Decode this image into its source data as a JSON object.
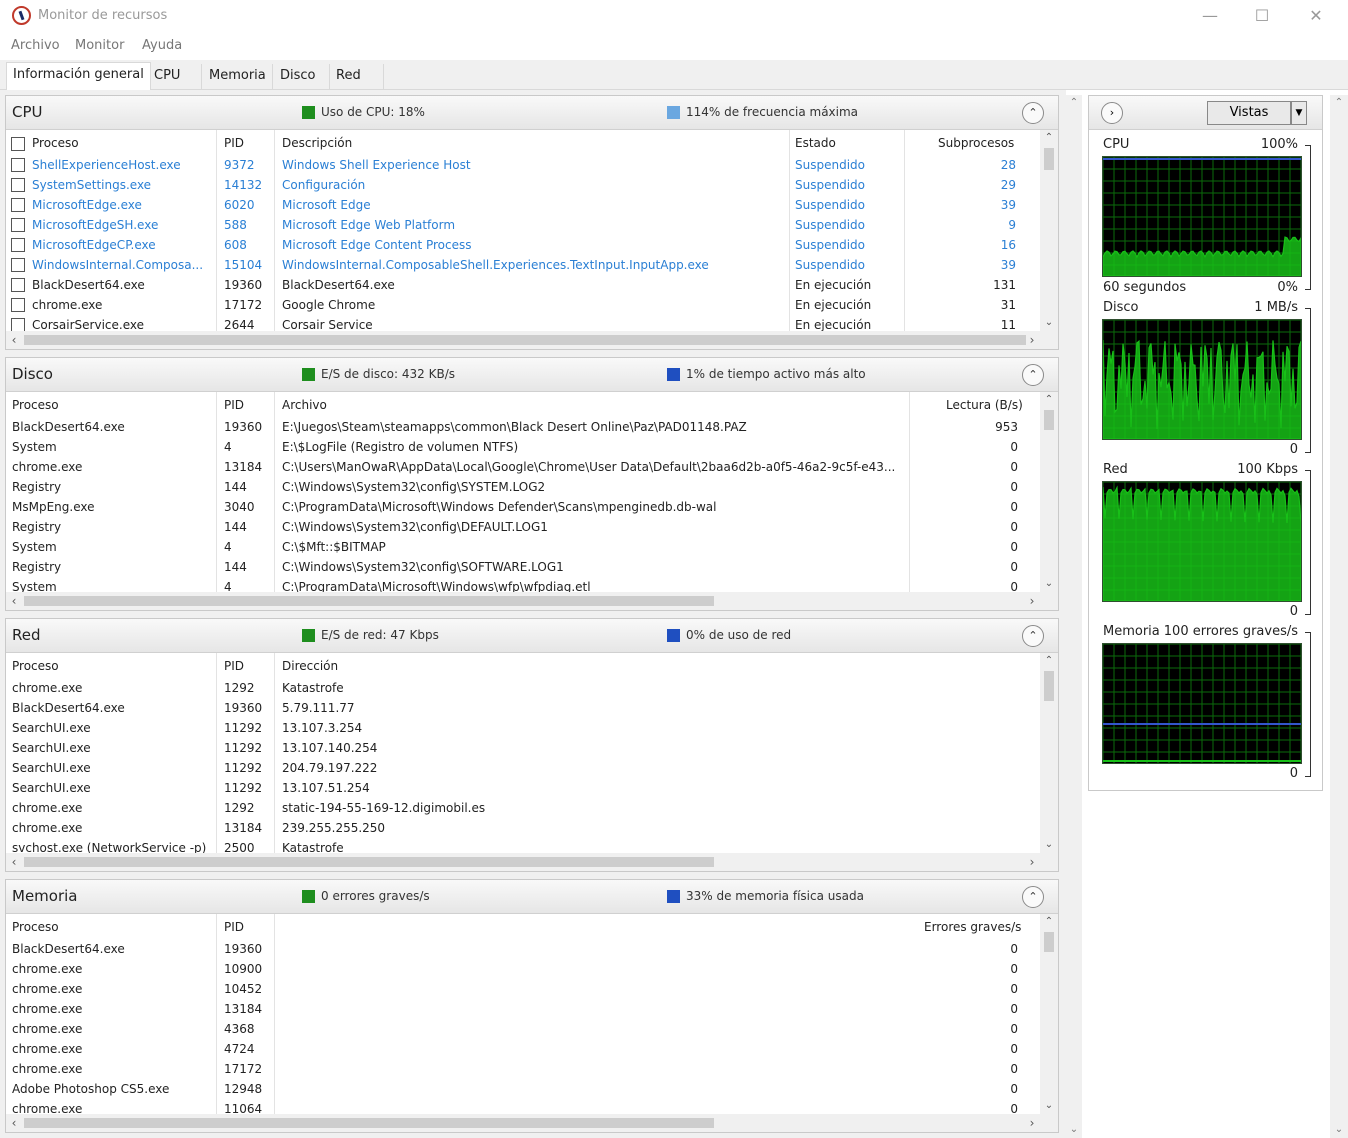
{
  "window": {
    "title": "Monitor de recursos",
    "minimize": "—",
    "maximize": "☐",
    "close": "✕"
  },
  "menu": [
    "Archivo",
    "Monitor",
    "Ayuda"
  ],
  "tabs": [
    "Información general",
    "CPU",
    "Memoria",
    "Disco",
    "Red"
  ],
  "colors": {
    "legend_green": "#1e8e1e",
    "legend_blue": "#1f4fc0",
    "link_blue": "#2a7fd4",
    "graph_green": "#18c018",
    "graph_grid": "#0b6b0b",
    "graph_blue_line": "#3355cc"
  },
  "cpu": {
    "title": "CPU",
    "legend1": "Uso de CPU: 18%",
    "legend2": "114% de frecuencia máxima",
    "headers": [
      "Proceso",
      "PID",
      "Descripción",
      "Estado",
      "Subprocesos"
    ],
    "rows": [
      [
        "ShellExperienceHost.exe",
        "9372",
        "Windows Shell Experience Host",
        "Suspendido",
        "28"
      ],
      [
        "SystemSettings.exe",
        "14132",
        "Configuración",
        "Suspendido",
        "29"
      ],
      [
        "MicrosoftEdge.exe",
        "6020",
        "Microsoft Edge",
        "Suspendido",
        "39"
      ],
      [
        "MicrosoftEdgeSH.exe",
        "588",
        "Microsoft Edge Web Platform",
        "Suspendido",
        "9"
      ],
      [
        "MicrosoftEdgeCP.exe",
        "608",
        "Microsoft Edge Content Process",
        "Suspendido",
        "16"
      ],
      [
        "WindowsInternal.Composa...",
        "15104",
        "WindowsInternal.ComposableShell.Experiences.TextInput.InputApp.exe",
        "Suspendido",
        "39"
      ],
      [
        "BlackDesert64.exe",
        "19360",
        "BlackDesert64.exe",
        "En ejecución",
        "131"
      ],
      [
        "chrome.exe",
        "17172",
        "Google Chrome",
        "En ejecución",
        "31"
      ],
      [
        "CorsairService.exe",
        "2644",
        "Corsair Service",
        "En ejecución",
        "11"
      ]
    ]
  },
  "disk": {
    "title": "Disco",
    "legend1": "E/S de disco: 432 KB/s",
    "legend2": "1% de tiempo activo más alto",
    "headers": [
      "Proceso",
      "PID",
      "Archivo",
      "Lectura (B/s)"
    ],
    "rows": [
      [
        "BlackDesert64.exe",
        "19360",
        "E:\\Juegos\\Steam\\steamapps\\common\\Black Desert Online\\Paz\\PAD01148.PAZ",
        "953"
      ],
      [
        "System",
        "4",
        "E:\\$LogFile (Registro de volumen NTFS)",
        "0"
      ],
      [
        "chrome.exe",
        "13184",
        "C:\\Users\\ManOwaR\\AppData\\Local\\Google\\Chrome\\User Data\\Default\\2baa6d2b-a0f5-46a2-9c5f-e43...",
        "0"
      ],
      [
        "Registry",
        "144",
        "C:\\Windows\\System32\\config\\SYSTEM.LOG2",
        "0"
      ],
      [
        "MsMpEng.exe",
        "3040",
        "C:\\ProgramData\\Microsoft\\Windows Defender\\Scans\\mpenginedb.db-wal",
        "0"
      ],
      [
        "Registry",
        "144",
        "C:\\Windows\\System32\\config\\DEFAULT.LOG1",
        "0"
      ],
      [
        "System",
        "4",
        "C:\\$Mft::$BITMAP",
        "0"
      ],
      [
        "Registry",
        "144",
        "C:\\Windows\\System32\\config\\SOFTWARE.LOG1",
        "0"
      ],
      [
        "System",
        "4",
        "C:\\ProgramData\\Microsoft\\Windows\\wfp\\wfpdiag.etl",
        "0"
      ]
    ]
  },
  "network": {
    "title": "Red",
    "legend1": "E/S de red: 47 Kbps",
    "legend2": "0% de uso de red",
    "headers": [
      "Proceso",
      "PID",
      "Dirección"
    ],
    "rows": [
      [
        "chrome.exe",
        "1292",
        "Katastrofe"
      ],
      [
        "BlackDesert64.exe",
        "19360",
        "5.79.111.77"
      ],
      [
        "SearchUI.exe",
        "11292",
        "13.107.3.254"
      ],
      [
        "SearchUI.exe",
        "11292",
        "13.107.140.254"
      ],
      [
        "SearchUI.exe",
        "11292",
        "204.79.197.222"
      ],
      [
        "SearchUI.exe",
        "11292",
        "13.107.51.254"
      ],
      [
        "chrome.exe",
        "1292",
        "static-194-55-169-12.digimobil.es"
      ],
      [
        "chrome.exe",
        "13184",
        "239.255.255.250"
      ],
      [
        "svchost.exe (NetworkService -p)",
        "2500",
        "Katastrofe"
      ]
    ]
  },
  "memory": {
    "title": "Memoria",
    "legend1": "0 errores graves/s",
    "legend2": "33% de memoria física usada",
    "headers": [
      "Proceso",
      "PID",
      "Errores graves/s"
    ],
    "rows": [
      [
        "BlackDesert64.exe",
        "19360",
        "0"
      ],
      [
        "chrome.exe",
        "10900",
        "0"
      ],
      [
        "chrome.exe",
        "10452",
        "0"
      ],
      [
        "chrome.exe",
        "13184",
        "0"
      ],
      [
        "chrome.exe",
        "4368",
        "0"
      ],
      [
        "chrome.exe",
        "4724",
        "0"
      ],
      [
        "chrome.exe",
        "17172",
        "0"
      ],
      [
        "Adobe Photoshop CS5.exe",
        "12948",
        "0"
      ],
      [
        "chrome.exe",
        "11064",
        "0"
      ]
    ]
  },
  "sidebar": {
    "views_label": "Vistas",
    "graphs": [
      {
        "name": "CPU",
        "max": "100%",
        "time": "60 segundos",
        "min": "0%"
      },
      {
        "name": "Disco",
        "max": "1 MB/s",
        "min": "0"
      },
      {
        "name": "Red",
        "max": "100 Kbps",
        "min": "0"
      },
      {
        "name": "Memoria",
        "max": "100 errores graves/s",
        "min": "0"
      }
    ]
  }
}
